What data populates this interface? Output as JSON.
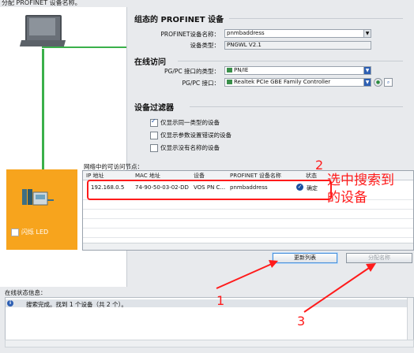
{
  "window_title": "分配 PROFINET 设备名称。",
  "configure": {
    "title": "组态的 PROFINET 设备",
    "device_name_label": "PROFINET设备名称：",
    "device_name_value": "pnmbaddress",
    "device_type_label": "设备类型：",
    "device_type_value": "PNGWL V2.1"
  },
  "online_access": {
    "title": "在线访问",
    "iface_type_label": "PG/PC 接口的类型：",
    "iface_type_value": "PN/IE",
    "iface_label": "PG/PC 接口：",
    "iface_value": "Realtek PCIe GBE Family Controller"
  },
  "filter": {
    "title": "设备过滤器",
    "options": [
      {
        "label": "仅显示同一类型的设备",
        "checked": true
      },
      {
        "label": "仅显示参数设置错误的设备",
        "checked": false
      },
      {
        "label": "仅显示没有名称的设备",
        "checked": false
      }
    ]
  },
  "table": {
    "caption": "网络中的可访问节点：",
    "headers": [
      "IP 地址",
      "MAC 地址",
      "设备",
      "PROFINET 设备名称",
      "状态"
    ],
    "rows": [
      {
        "ip": "192.168.0.5",
        "mac": "74-90-50-03-02-DD",
        "device": "VOS PN C...",
        "name": "pnmbaddress",
        "status": "确定"
      }
    ]
  },
  "device_panel": {
    "led_label": "闪烁 LED"
  },
  "buttons": {
    "refresh": "更新列表",
    "assign": "分配名称"
  },
  "status": {
    "title": "在线状态信息：",
    "message": "搜索完成。找到 1 个设备（共 2 个）。"
  },
  "annotations": {
    "label_1": "1",
    "label_2": "2",
    "label_3": "3",
    "callout": "选中搜索到的设备",
    "color": "#ff1b1b"
  }
}
